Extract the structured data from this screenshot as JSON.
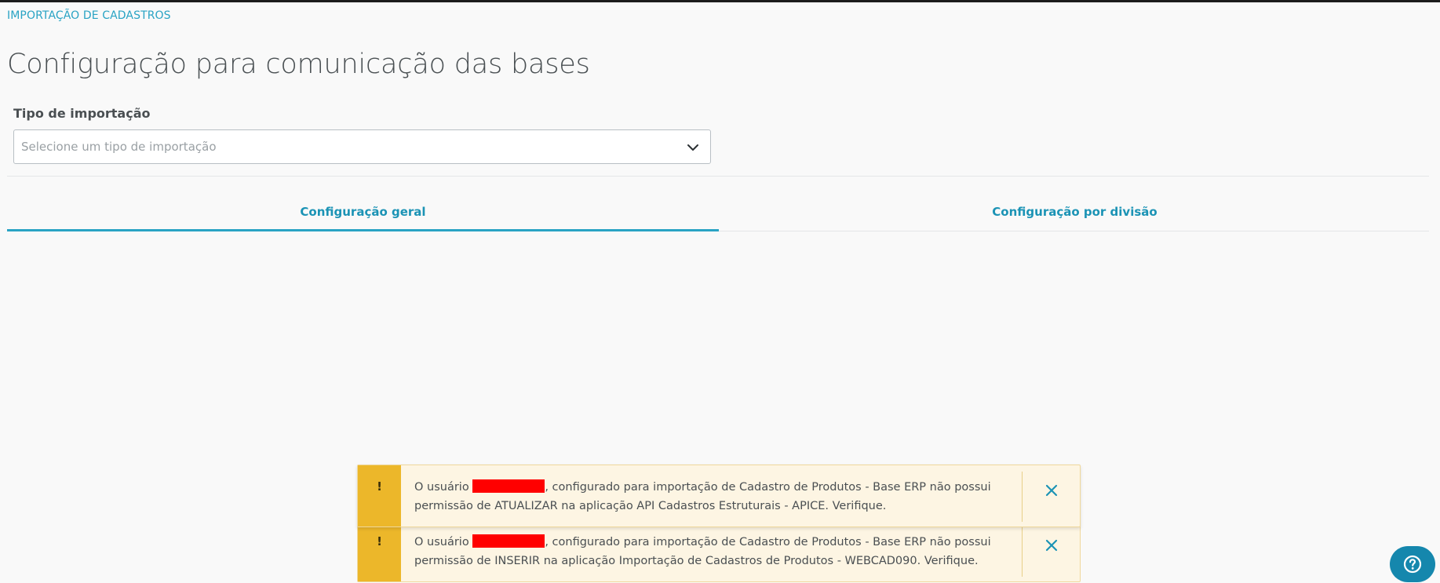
{
  "breadcrumb": "IMPORTAÇÃO DE CADASTROS",
  "page_title": "Configuração para comunicação das bases",
  "import_type": {
    "label": "Tipo de importação",
    "placeholder": "Selecione um tipo de importação",
    "icon": "chevron-down-icon"
  },
  "tabs": [
    {
      "label": "Configuração geral",
      "active": true
    },
    {
      "label": "Configuração por divisão",
      "active": false
    }
  ],
  "notifications": [
    {
      "type": "warning",
      "icon_text": "!",
      "text_before": "O usuário ",
      "text_after": ", configurado para importação de Cadastro de Produtos - Base ERP não possui permissão de ATUALIZAR na aplicação API Cadastros Estruturais - APICE. Verifique.",
      "close_icon": "close-icon"
    },
    {
      "type": "warning",
      "icon_text": "!",
      "text_before": "O usuário ",
      "text_after": ", configurado para importação de Cadastro de Produtos - Base ERP não possui permissão de INSERIR na aplicação Importação de Cadastros de Produtos - WEBCAD090. Verifique.",
      "close_icon": "close-icon"
    }
  ],
  "help_button": {
    "icon": "help-icon"
  },
  "colors": {
    "accent": "#29a3c4",
    "warning": "#ecb72a",
    "warning_bg": "#fdf5e3",
    "redaction": "#ff0000",
    "help_button": "#1587ad"
  }
}
